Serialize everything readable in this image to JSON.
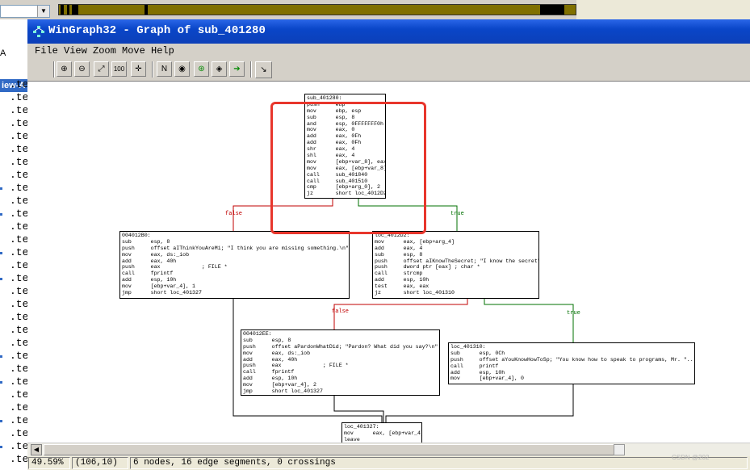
{
  "window": {
    "title": "WinGraph32 - Graph of sub_401280"
  },
  "background": {
    "left_letter": "A",
    "view_tab": "iew-A",
    "code_rows": [
      ".te",
      ".te",
      ".te",
      ".te",
      ".te",
      ".te",
      ".te",
      ".te",
      ".te",
      ".te",
      ".te",
      ".te",
      ".te",
      ".te",
      ".te",
      ".te",
      ".te",
      ".te",
      ".te",
      ".te",
      ".te",
      ".te",
      ".te",
      ".te",
      ".te",
      ".te",
      ".te",
      ".te",
      ".te",
      ".te"
    ]
  },
  "menu": [
    {
      "label": "File"
    },
    {
      "label": "View"
    },
    {
      "label": "Zoom"
    },
    {
      "label": "Move"
    },
    {
      "label": "Help"
    }
  ],
  "toolbar": [
    {
      "icon": "zoom-in-icon",
      "glyph": "⊕"
    },
    {
      "icon": "zoom-out-icon",
      "glyph": "⊖"
    },
    {
      "icon": "fit-window-icon",
      "glyph": "⤢"
    },
    {
      "icon": "zoom-100-icon",
      "glyph": "100"
    },
    {
      "icon": "center-icon",
      "glyph": "✛"
    },
    {
      "icon": "layout-icon",
      "glyph": "N"
    },
    {
      "icon": "overview-icon",
      "glyph": "◉"
    },
    {
      "icon": "pan-icon",
      "glyph": "⊛"
    },
    {
      "icon": "fisheye-icon",
      "glyph": "◈"
    },
    {
      "icon": "arrow-right-icon",
      "glyph": "➔"
    },
    {
      "icon": "cursor-icon",
      "glyph": "↘"
    }
  ],
  "colors": {
    "false_edge": "#c00000",
    "true_edge": "#007000",
    "highlight": "#e8362c"
  },
  "nodes": [
    {
      "id": "n1",
      "lines": [
        "sub_401280:",
        "push     ebp",
        "mov      ebp, esp",
        "sub      esp, 8",
        "and      esp, 0FFFFFFF0h",
        "mov      eax, 0",
        "add      eax, 0Fh",
        "add      eax, 0Fh",
        "shr      eax, 4",
        "shl      eax, 4",
        "mov      [ebp+var_8], eax",
        "mov      eax, [ebp+var_8]",
        "call     sub_401840",
        "call     sub_401510",
        "cmp      [ebp+arg_0], 2",
        "jz       short loc_4012D2"
      ]
    },
    {
      "id": "n2",
      "lines": [
        "004012B0:",
        "sub      esp, 8",
        "push     offset aIThinkYouAreMi; \"I think you are missing something.\\n\"",
        "mov      eax, ds:_iob",
        "add      eax, 40h",
        "push     eax             ; FILE *",
        "call     fprintf",
        "add      esp, 10h",
        "mov      [ebp+var_4], 1",
        "jmp      short loc_401327"
      ]
    },
    {
      "id": "n3",
      "lines": [
        "loc_4012D2:",
        "mov      eax, [ebp+arg_4]",
        "add      eax, 4",
        "sub      esp, 8",
        "push     offset aIKnowTheSecret; \"I know the secret\"",
        "push     dword ptr [eax] ; char *",
        "call     strcmp",
        "add      esp, 10h",
        "test     eax, eax",
        "jz       short loc_401310"
      ]
    },
    {
      "id": "n4",
      "lines": [
        "004012EE:",
        "sub      esp, 8",
        "push     offset aPardonWhatDid; \"Pardon? What did you say?\\n\"",
        "mov      eax, ds:_iob",
        "add      eax, 40h",
        "push     eax             ; FILE *",
        "call     fprintf",
        "add      esp, 10h",
        "mov      [ebp+var_4], 2",
        "jmp      short loc_401327"
      ]
    },
    {
      "id": "n5",
      "lines": [
        "loc_401310:",
        "sub      esp, 0Ch",
        "push     offset aYouKnowHowToSp; \"You know how to speak to programs, Mr. \"...",
        "call     printf",
        "add      esp, 10h",
        "mov      [ebp+var_4], 0"
      ]
    },
    {
      "id": "n6",
      "lines": [
        "loc_401327:",
        "mov      eax, [ebp+var_4]",
        "leave"
      ]
    }
  ],
  "edge_labels": {
    "false1": "false",
    "true1": "true",
    "false2": "false",
    "true2": "true"
  },
  "status": {
    "zoom": "49.59%",
    "coords": "(106,10)",
    "summary": "6 nodes, 16 edge segments, 0 crossings"
  },
  "watermark": "CSDN @202"
}
